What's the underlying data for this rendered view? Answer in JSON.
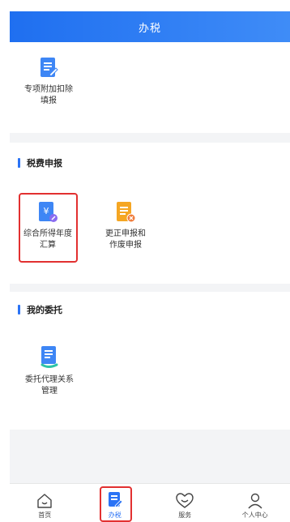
{
  "header": {
    "title": "办税"
  },
  "top_section": {
    "tiles": [
      {
        "label_line1": "专项附加扣除",
        "label_line2": "填报"
      }
    ]
  },
  "tax_section": {
    "title": "税费申报",
    "tiles": [
      {
        "label_line1": "综合所得年度",
        "label_line2": "汇算",
        "icon_char": "¥"
      },
      {
        "label_line1": "更正申报和",
        "label_line2": "作废申报"
      }
    ]
  },
  "delegation_section": {
    "title": "我的委托",
    "tiles": [
      {
        "label_line1": "委托代理关系",
        "label_line2": "管理"
      }
    ]
  },
  "bottom_nav": {
    "items": [
      {
        "label": "首页",
        "icon": "home-icon"
      },
      {
        "label": "办税",
        "icon": "tax-icon",
        "active": true
      },
      {
        "label": "服务",
        "icon": "heart-icon"
      },
      {
        "label": "个人中心",
        "icon": "person-icon"
      }
    ]
  },
  "colors": {
    "accent": "#2b73f5",
    "highlight": "#e23030",
    "orange": "#f5a623"
  }
}
